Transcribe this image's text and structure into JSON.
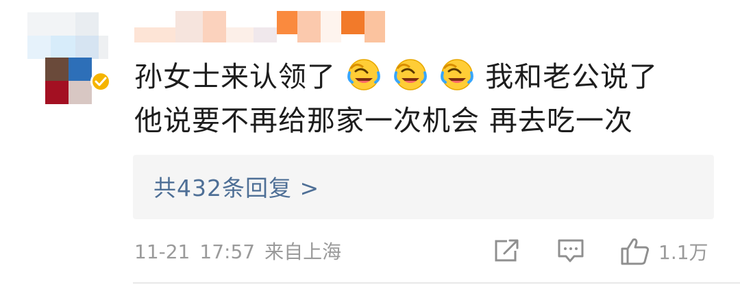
{
  "comment": {
    "line1_a": "孙女士来认领了",
    "line1_b": "我和老公说了",
    "line2": "他说要不再给那家一次机会 再去吃一次",
    "emoji_name": "laugh-cry-emoji"
  },
  "replies": {
    "label": "共432条回复 >"
  },
  "meta": {
    "date": "11-21",
    "time": "17:57",
    "source": "来自上海"
  },
  "actions": {
    "like_count": "1.1万"
  },
  "colors": {
    "link": "#4e6f96",
    "meta": "#9a9a9a",
    "badge": "#f5b400",
    "reply_bg": "#f5f5f5"
  }
}
